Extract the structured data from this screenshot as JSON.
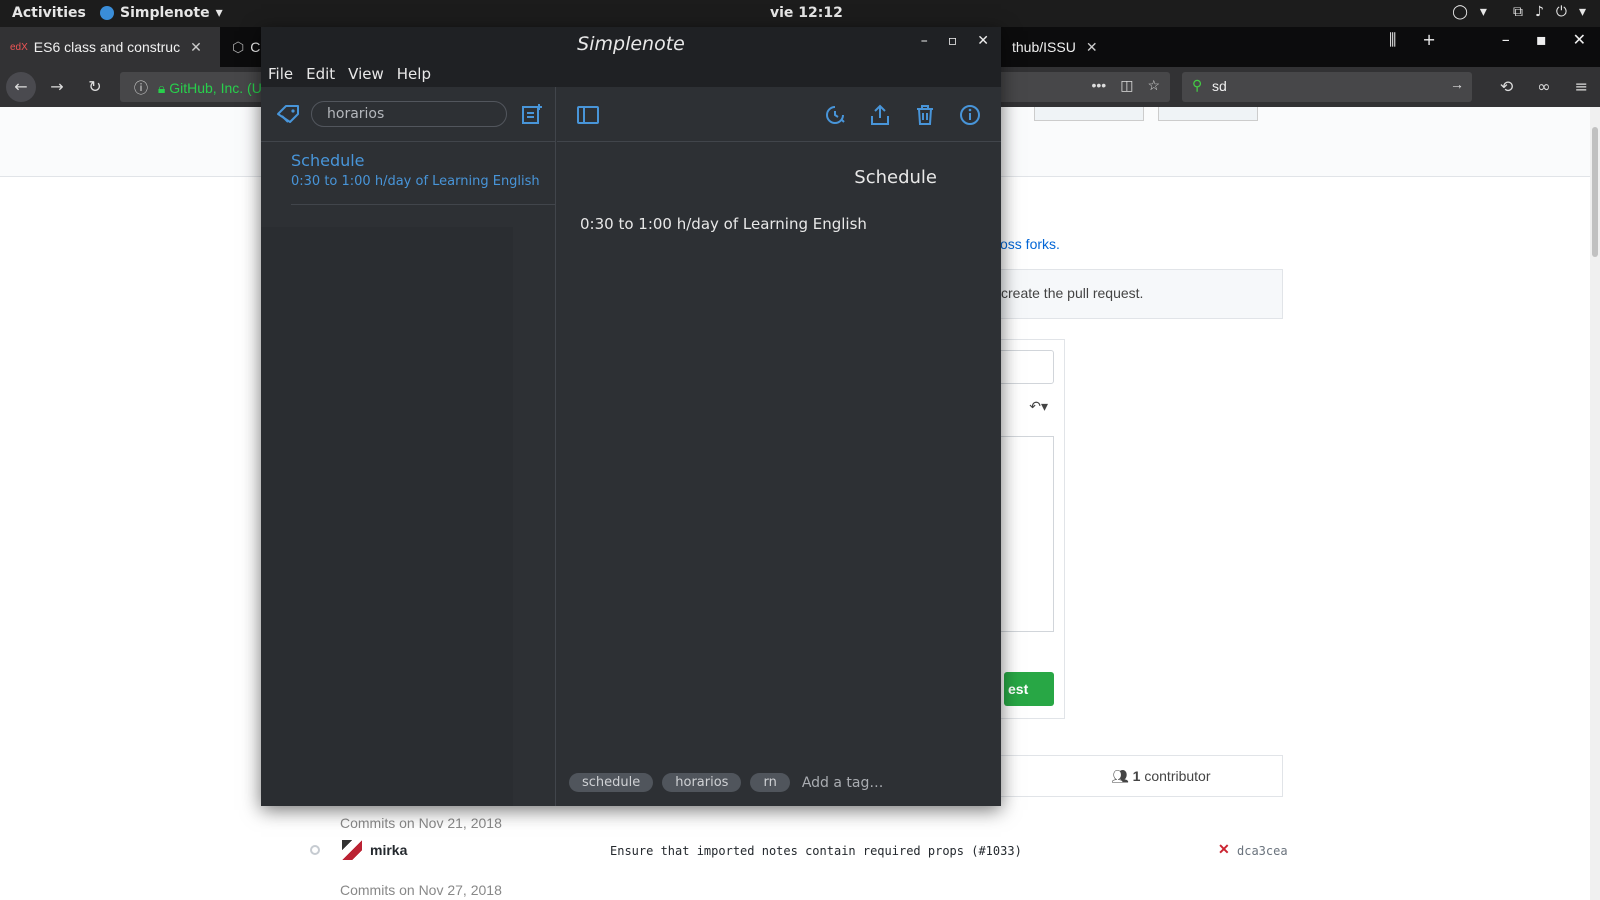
{
  "topbar": {
    "activities": "Activities",
    "app_name": "Simplenote",
    "clock": "vie 12:12"
  },
  "firefox": {
    "tabs": [
      {
        "label": "ES6 class and construc",
        "close": "✕"
      },
      {
        "label": "C",
        "close": ""
      },
      {
        "label": "thub/ISSU",
        "close": "✕"
      }
    ],
    "url_text": "GitHub, Inc. (U",
    "search_value": "sd"
  },
  "github": {
    "link_forks": "oss forks.",
    "info_text": "create the pull request.",
    "green_button": "est",
    "contributors_count": "1",
    "contributors_label": "contributor",
    "commits_header_1": "Commits on Nov 21, 2018",
    "commit": {
      "author": "mirka",
      "message": "Ensure that imported notes contain required props (#1033)",
      "sha": "dca3cea"
    },
    "commits_header_2": "Commits on Nov 27, 2018"
  },
  "simplenote": {
    "window_title": "Simplenote",
    "menu": [
      "File",
      "Edit",
      "View",
      "Help"
    ],
    "search_value": "horarios",
    "notes": [
      {
        "title": "Schedule",
        "preview": "0:30 to 1:00 h/day of Learning English"
      }
    ],
    "editor": {
      "title": "Schedule",
      "body": "0:30 to 1:00 h/day of Learning English",
      "tags": [
        "schedule",
        "horarios",
        "rn"
      ],
      "add_tag_placeholder": "Add a tag…"
    },
    "colors": {
      "accent": "#4895d9",
      "background": "#2d3034",
      "titlebar": "#1f2124"
    }
  }
}
